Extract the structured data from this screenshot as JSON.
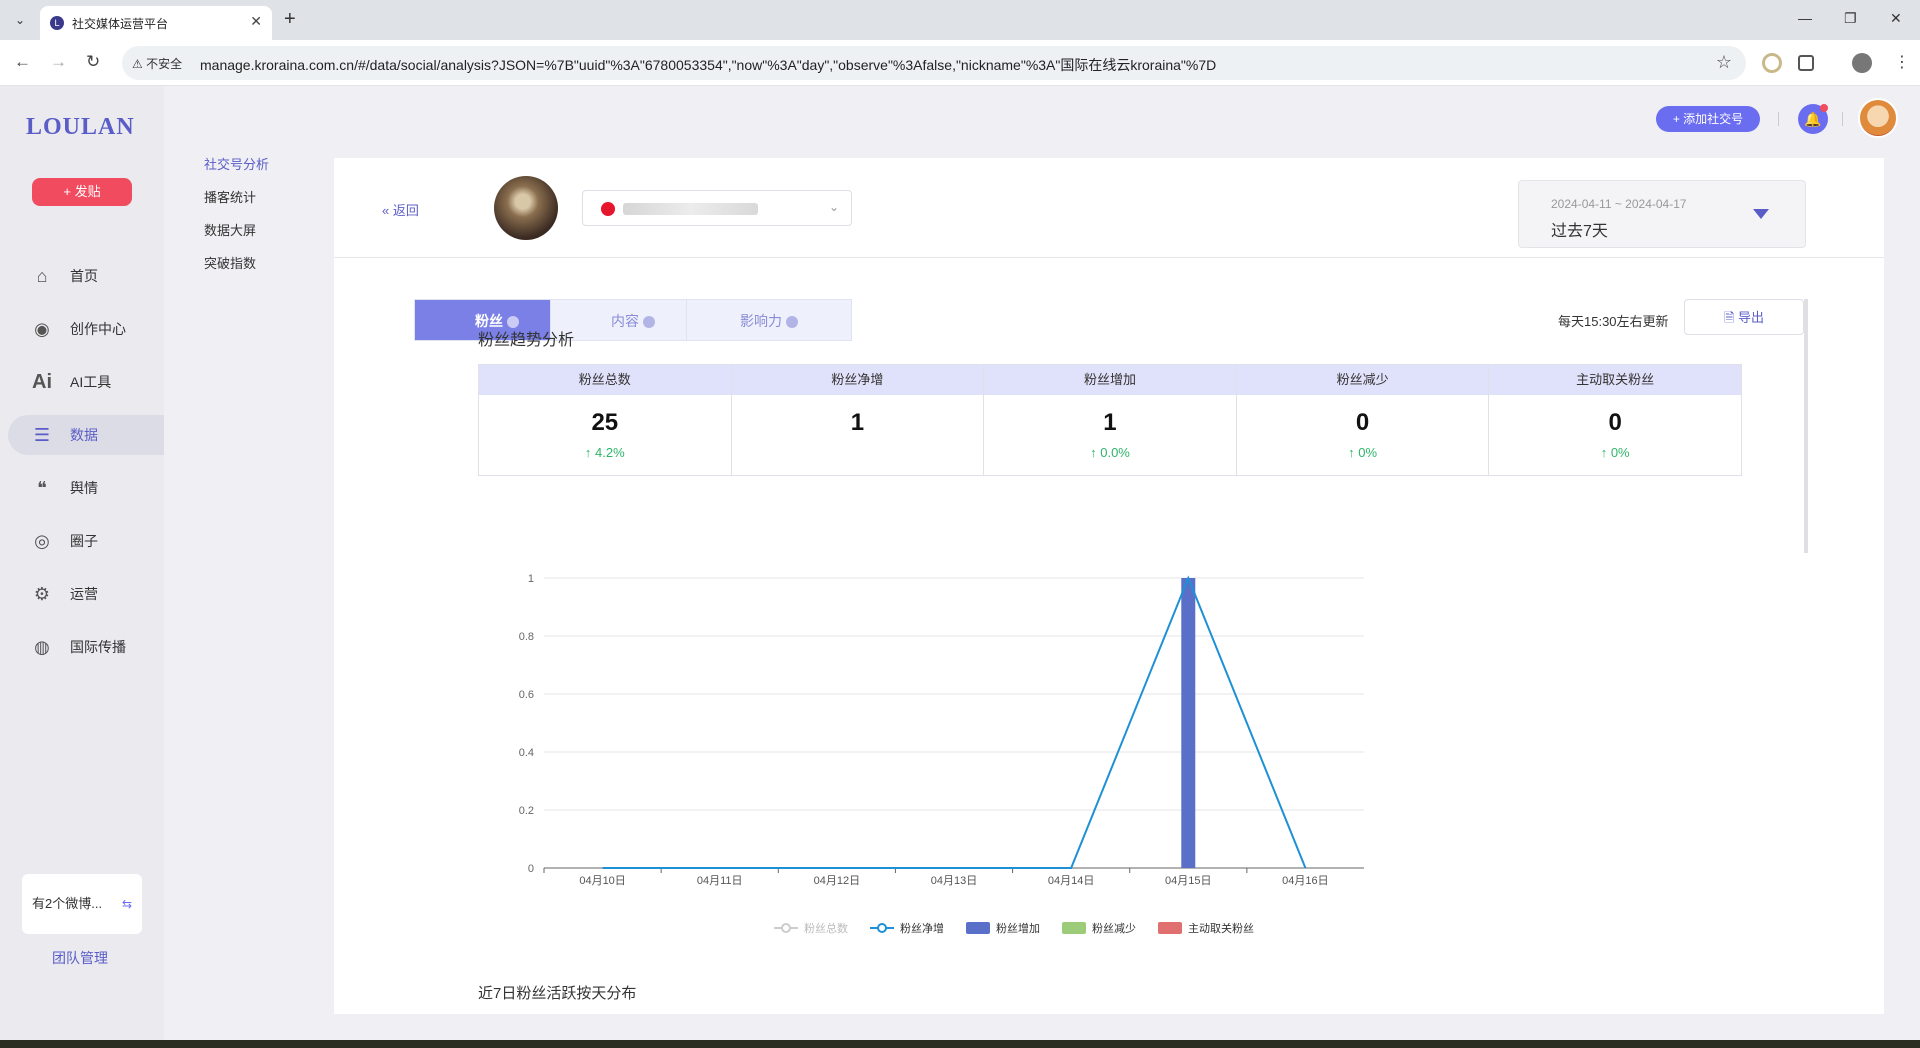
{
  "browser": {
    "tab_title": "社交媒体运营平台",
    "tab_close": "✕",
    "new_tab": "+",
    "security": "不安全",
    "url": "manage.kroraina.com.cn/#/data/social/analysis?JSON=%7B\"uuid\"%3A\"6780053354\",\"now\"%3A\"day\",\"observe\"%3Afalse,\"nickname\"%3A\"国际在线云kroraina\"%7D"
  },
  "app": {
    "logo": "LOULAN",
    "post_button": "+ 发贴",
    "nav": [
      {
        "label": "首页",
        "icon": "home-icon"
      },
      {
        "label": "创作中心",
        "icon": "palette-icon"
      },
      {
        "label": "AI工具",
        "icon": "ai-icon"
      },
      {
        "label": "数据",
        "icon": "database-icon"
      },
      {
        "label": "舆情",
        "icon": "quote-icon"
      },
      {
        "label": "圈子",
        "icon": "compass-icon"
      },
      {
        "label": "运营",
        "icon": "gear-icon"
      },
      {
        "label": "国际传播",
        "icon": "globe-icon"
      }
    ],
    "account_card": "有2个微博...",
    "team_link": "团队管理",
    "subnav": [
      "社交号分析",
      "播客统计",
      "数据大屏",
      "突破指数"
    ],
    "add_social": "+ 添加社交号"
  },
  "header": {
    "back": "« 返回",
    "date_range": "2024-04-11 ~ 2024-04-17",
    "period": "过去7天"
  },
  "tabs": [
    "粉丝",
    "内容",
    "影响力"
  ],
  "update_note": "每天15:30左右更新",
  "export": "导出",
  "section_title": "粉丝趋势分析",
  "section_title_2": "近7日粉丝活跃按天分布",
  "stats": [
    {
      "label": "粉丝总数",
      "value": "25",
      "change": "↑ 4.2%"
    },
    {
      "label": "粉丝净增",
      "value": "1",
      "change": ""
    },
    {
      "label": "粉丝增加",
      "value": "1",
      "change": "↑ 0.0%"
    },
    {
      "label": "粉丝减少",
      "value": "0",
      "change": "↑ 0%"
    },
    {
      "label": "主动取关粉丝",
      "value": "0",
      "change": "↑ 0%"
    }
  ],
  "chart_data": {
    "type": "line",
    "categories": [
      "04月10日",
      "04月11日",
      "04月12日",
      "04月13日",
      "04月14日",
      "04月15日",
      "04月16日"
    ],
    "ylim": [
      0,
      1
    ],
    "yticks": [
      "0",
      "0.2",
      "0.4",
      "0.6",
      "0.8",
      "1"
    ],
    "series": [
      {
        "name": "粉丝总数",
        "kind": "line",
        "color": "#cccccc",
        "values": null
      },
      {
        "name": "粉丝净增",
        "kind": "line",
        "color": "#1e90d6",
        "values": [
          0,
          0,
          0,
          0,
          0,
          1,
          0
        ]
      },
      {
        "name": "粉丝增加",
        "kind": "bar",
        "color": "#5a70c8",
        "values": [
          0,
          0,
          0,
          0,
          0,
          1,
          0
        ]
      },
      {
        "name": "粉丝减少",
        "kind": "bar",
        "color": "#9ccc7a",
        "values": [
          0,
          0,
          0,
          0,
          0,
          0,
          0
        ]
      },
      {
        "name": "主动取关粉丝",
        "kind": "bar",
        "color": "#e07070",
        "values": [
          0,
          0,
          0,
          0,
          0,
          0,
          0
        ]
      }
    ],
    "legend_position": "bottom-center"
  }
}
